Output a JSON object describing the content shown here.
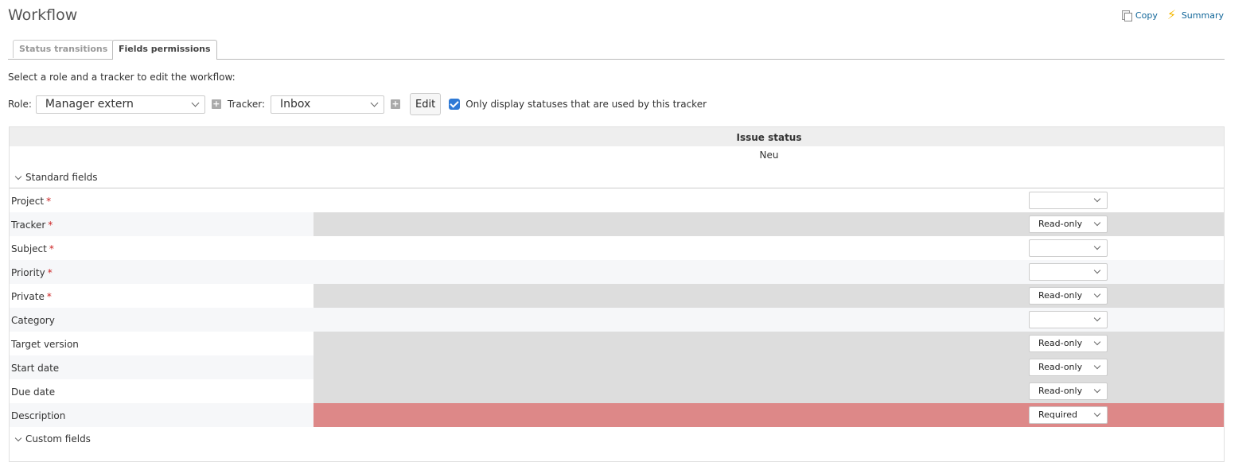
{
  "page": {
    "title": "Workflow",
    "actions": {
      "copy": "Copy",
      "summary": "Summary"
    }
  },
  "tabs": [
    {
      "label": "Status transitions",
      "selected": false
    },
    {
      "label": "Fields permissions",
      "selected": true
    }
  ],
  "intro": "Select a role and a tracker to edit the workflow:",
  "filters": {
    "role_label": "Role:",
    "role_value": "Manager extern",
    "tracker_label": "Tracker:",
    "tracker_value": "Inbox",
    "edit_label": "Edit",
    "only_used_label": "Only display statuses that are used by this tracker",
    "only_used_checked": true
  },
  "table": {
    "header": "Issue status",
    "status": "Neu",
    "standard_group": "Standard fields",
    "custom_group": "Custom fields",
    "rows": [
      {
        "field": "Project",
        "required": "*",
        "permission": "",
        "state": "none"
      },
      {
        "field": "Tracker",
        "required": "*",
        "permission": "Read-only",
        "state": "readonly"
      },
      {
        "field": "Subject",
        "required": "*",
        "permission": "",
        "state": "none"
      },
      {
        "field": "Priority",
        "required": "*",
        "permission": "",
        "state": "none"
      },
      {
        "field": "Private",
        "required": "*",
        "permission": "Read-only",
        "state": "readonly"
      },
      {
        "field": "Category",
        "required": "",
        "permission": "",
        "state": "none"
      },
      {
        "field": "Target version",
        "required": "",
        "permission": "Read-only",
        "state": "readonly"
      },
      {
        "field": "Start date",
        "required": "",
        "permission": "Read-only",
        "state": "readonly"
      },
      {
        "field": "Due date",
        "required": "",
        "permission": "Read-only",
        "state": "readonly"
      },
      {
        "field": "Description",
        "required": "",
        "permission": "Required",
        "state": "required"
      }
    ]
  },
  "colors": {
    "readonly": "#dddddd",
    "required": "#dd8888",
    "link": "#116699",
    "accent": "#2f7ad6"
  }
}
